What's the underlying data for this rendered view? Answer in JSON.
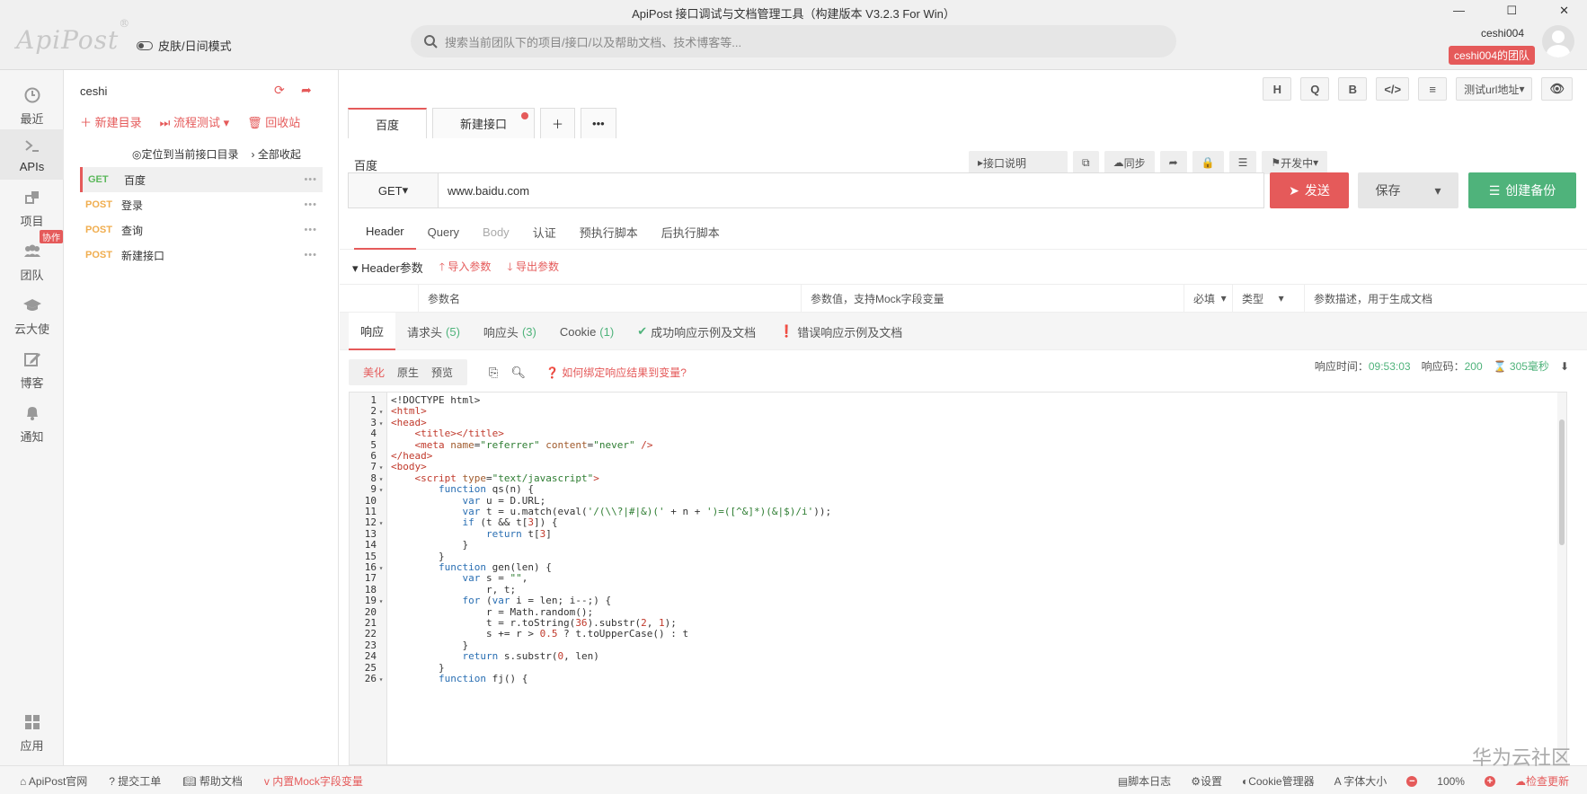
{
  "window": {
    "title": "ApiPost 接口调试与文档管理工具（构建版本 V3.2.3 For Win）",
    "controls": [
      "—",
      "☐",
      "✕"
    ]
  },
  "header": {
    "logo": "ApiPost",
    "logo_mark": "®",
    "skin_toggle": "皮肤/日间模式",
    "search_placeholder": "搜索当前团队下的项目/接口/以及帮助文档、技术博客等...",
    "username": "ceshi004",
    "team": "ceshi004的团队"
  },
  "rail": {
    "items": [
      {
        "label": "最近",
        "icon": "clock-icon"
      },
      {
        "label": "APIs",
        "icon": "terminal-icon"
      },
      {
        "label": "项目",
        "icon": "project-icon"
      },
      {
        "label": "团队",
        "icon": "team-icon",
        "badge": "协作"
      },
      {
        "label": "云大使",
        "icon": "graduation-cap-icon"
      },
      {
        "label": "博客",
        "icon": "edit-icon"
      },
      {
        "label": "通知",
        "icon": "bell-icon"
      }
    ],
    "apps": "应用"
  },
  "tree": {
    "project": "ceshi",
    "new_dir": "新建目录",
    "flow_test": "流程测试",
    "recycle": "回收站",
    "locate": "定位到当前接口目录",
    "collapse": "全部收起",
    "apis": [
      {
        "method": "GET",
        "name": "百度"
      },
      {
        "method": "POST",
        "name": "登录"
      },
      {
        "method": "POST",
        "name": "查询"
      },
      {
        "method": "POST",
        "name": "新建接口"
      }
    ]
  },
  "toolbar": {
    "buttons": [
      "H",
      "Q",
      "B",
      "</>",
      "≡"
    ],
    "env": "测试url地址"
  },
  "tabs": [
    {
      "label": "百度"
    },
    {
      "label": "新建接口"
    }
  ],
  "request": {
    "name": "百度",
    "desc_btn": "接口说明",
    "sync": "同步",
    "status": "开发中",
    "method": "GET",
    "url": "www.baidu.com",
    "send": "发送",
    "save": "保存",
    "backup": "创建备份",
    "tabs": [
      "Header",
      "Query",
      "Body",
      "认证",
      "预执行脚本",
      "后执行脚本"
    ]
  },
  "header_params": {
    "title": "Header参数",
    "import": "导入参数",
    "export": "导出参数",
    "cols": [
      "参数名",
      "参数值，支持Mock字段变量",
      "必填",
      "类型",
      "参数描述，用于生成文档"
    ]
  },
  "response": {
    "tabs": [
      {
        "label": "响应",
        "count": ""
      },
      {
        "label": "请求头",
        "count": "(5)"
      },
      {
        "label": "响应头",
        "count": "(3)"
      },
      {
        "label": "Cookie",
        "count": "(1)"
      },
      {
        "label": "成功响应示例及文档",
        "count": ""
      },
      {
        "label": "错误响应示例及文档",
        "count": ""
      }
    ],
    "views": [
      "美化",
      "原生",
      "预览"
    ],
    "hint": "如何绑定响应结果到变量?",
    "time_label": "响应时间：",
    "time_value": "09:53:03",
    "code_label": "响应码：",
    "code_value": "200",
    "duration": "305毫秒"
  },
  "code_lines": [
    "<!DOCTYPE html>",
    "<html>",
    "<head>",
    "    <title></title>",
    "    <meta name=\"referrer\" content=\"never\" />",
    "</head>",
    "<body>",
    "    <script type=\"text/javascript\">",
    "        function qs(n) {",
    "            var u = D.URL;",
    "            var t = u.match(eval('/(\\\\?|#|&)(' + n + ')=([^&]*)(&|$)/i'));",
    "            if (t && t[3]) {",
    "                return t[3]",
    "            }",
    "        }",
    "        function gen(len) {",
    "            var s = \"\",",
    "                r, t;",
    "            for (var i = len; i--;) {",
    "                r = Math.random();",
    "                t = r.toString(36).substr(2, 1);",
    "                s += r > 0.5 ? t.toUpperCase() : t",
    "            }",
    "            return s.substr(0, len)",
    "        }",
    "        function fj() {"
  ],
  "footer": {
    "left": [
      "ApiPost官网",
      "提交工单",
      "帮助文档",
      "内置Mock字段变量"
    ],
    "right": [
      "脚本日志",
      "设置",
      "Cookie管理器",
      "字体大小",
      "100%",
      "检查更新"
    ]
  },
  "watermark": "华为云社区"
}
